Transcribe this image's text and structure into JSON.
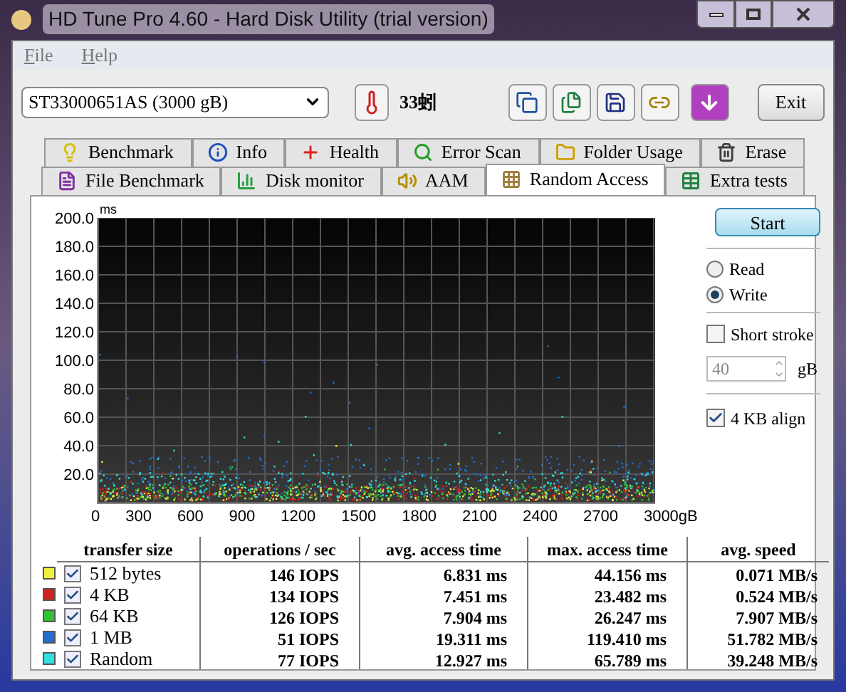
{
  "window": {
    "title": "HD Tune Pro 4.60 - Hard Disk Utility (trial version)"
  },
  "menu": [
    "File",
    "Help"
  ],
  "toolbar": {
    "drive": "ST33000651AS (3000 gB)",
    "temperature": "33蚓",
    "exit": "Exit"
  },
  "tab_rows": [
    [
      {
        "label": "Benchmark",
        "selected": false
      },
      {
        "label": "Info",
        "selected": false
      },
      {
        "label": "Health",
        "selected": false
      },
      {
        "label": "Error Scan",
        "selected": false
      },
      {
        "label": "Folder Usage",
        "selected": false
      },
      {
        "label": "Erase",
        "selected": false
      }
    ],
    [
      {
        "label": "File Benchmark",
        "selected": false
      },
      {
        "label": "Disk monitor",
        "selected": false
      },
      {
        "label": "AAM",
        "selected": false
      },
      {
        "label": "Random Access",
        "selected": true
      },
      {
        "label": "Extra tests",
        "selected": false
      }
    ]
  ],
  "chart": {
    "y_unit": "ms",
    "y_labels": [
      "200.0",
      "180.0",
      "160.0",
      "140.0",
      "120.0",
      "100.0",
      "80.0",
      "60.0",
      "40.0",
      "20.0"
    ],
    "x_labels": [
      "0",
      "300",
      "600",
      "900",
      "1200",
      "1500",
      "1800",
      "2100",
      "2400",
      "2700",
      "3000gB"
    ]
  },
  "side": {
    "start": "Start",
    "modes": [
      {
        "label": "Read",
        "selected": false
      },
      {
        "label": "Write",
        "selected": true
      }
    ],
    "short_stroke": {
      "label": "Short stroke",
      "checked": false,
      "value": "40",
      "unit": "gB"
    },
    "align": {
      "label": "4 KB align",
      "checked": true
    }
  },
  "table": {
    "columns": [
      "transfer size",
      "operations / sec",
      "avg. access time",
      "max. access time",
      "avg. speed"
    ],
    "rows": [
      {
        "color": "#f0f040",
        "checked": true,
        "size": "512 bytes",
        "ops": "146 IOPS",
        "avg": "6.831 ms",
        "max": "44.156 ms",
        "speed": "0.071 MB/s"
      },
      {
        "color": "#d02020",
        "checked": true,
        "size": "4 KB",
        "ops": "134 IOPS",
        "avg": "7.451 ms",
        "max": "23.482 ms",
        "speed": "0.524 MB/s"
      },
      {
        "color": "#30c030",
        "checked": true,
        "size": "64 KB",
        "ops": "126 IOPS",
        "avg": "7.904 ms",
        "max": "26.247 ms",
        "speed": "7.907 MB/s"
      },
      {
        "color": "#2070d0",
        "checked": true,
        "size": "1 MB",
        "ops": "51 IOPS",
        "avg": "19.311 ms",
        "max": "119.410 ms",
        "speed": "51.782 MB/s"
      },
      {
        "color": "#30e0e0",
        "checked": true,
        "size": "Random",
        "ops": "77 IOPS",
        "avg": "12.927 ms",
        "max": "65.789 ms",
        "speed": "39.248 MB/s"
      }
    ]
  }
}
